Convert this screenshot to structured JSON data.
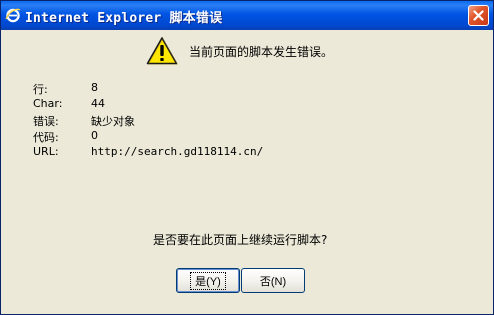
{
  "window": {
    "title": "Internet Explorer 脚本错误",
    "title_icon": "ie-icon",
    "close_icon": "close-icon"
  },
  "message": {
    "icon": "warning-icon",
    "text": "当前页面的脚本发生错误。"
  },
  "details": [
    {
      "label": "行:",
      "value": "8"
    },
    {
      "label": "Char:",
      "value": "44"
    },
    {
      "label": "错误:",
      "value": "缺少对象"
    },
    {
      "label": "代码:",
      "value": "0"
    },
    {
      "label": "URL:",
      "value": "http://search.gd118114.cn/"
    }
  ],
  "question": "是否要在此页面上继续运行脚本?",
  "buttons": {
    "yes": "是(Y)",
    "no": "否(N)"
  },
  "colors": {
    "titlebar": "#0054e3",
    "dialog_bg": "#ece9d8",
    "close_button": "#e0562c",
    "warning": "#ffe600"
  }
}
